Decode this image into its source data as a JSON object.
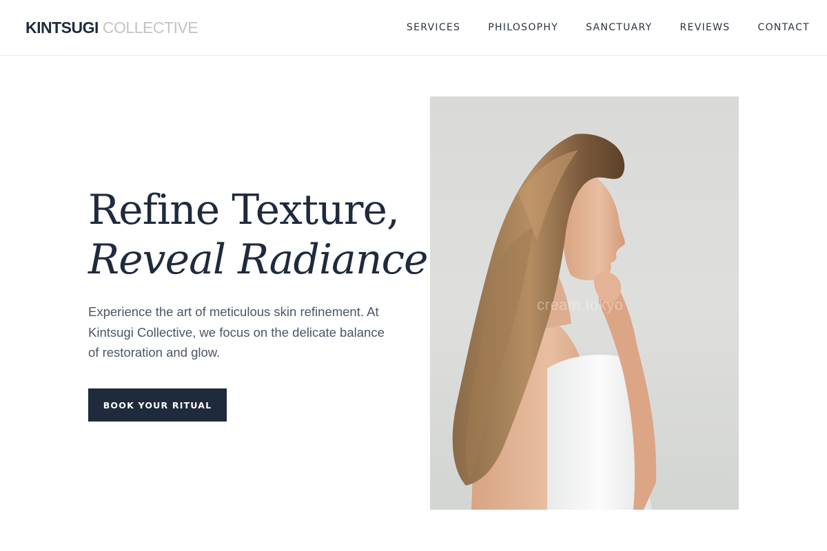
{
  "brand": {
    "name_strong": "KINTSUGI",
    "name_light": "COLLECTIVE",
    "primary_color": "#1f2a3c",
    "muted_color": "#c3c3c3"
  },
  "nav": {
    "items": [
      {
        "label": "SERVICES"
      },
      {
        "label": "PHILOSOPHY"
      },
      {
        "label": "SANCTUARY"
      },
      {
        "label": "REVIEWS"
      },
      {
        "label": "CONTACT"
      }
    ]
  },
  "hero": {
    "title_line1": "Refine Texture,",
    "title_line2": "Reveal Radiance.",
    "description": "Experience the art of meticulous skin refinement. At Kintsugi Collective, we focus on the delicate balance of restoration and glow.",
    "cta_label": "BOOK YOUR RITUAL",
    "image": {
      "subject": "woman-profile-photo",
      "watermark": "cream.tokyo"
    }
  }
}
